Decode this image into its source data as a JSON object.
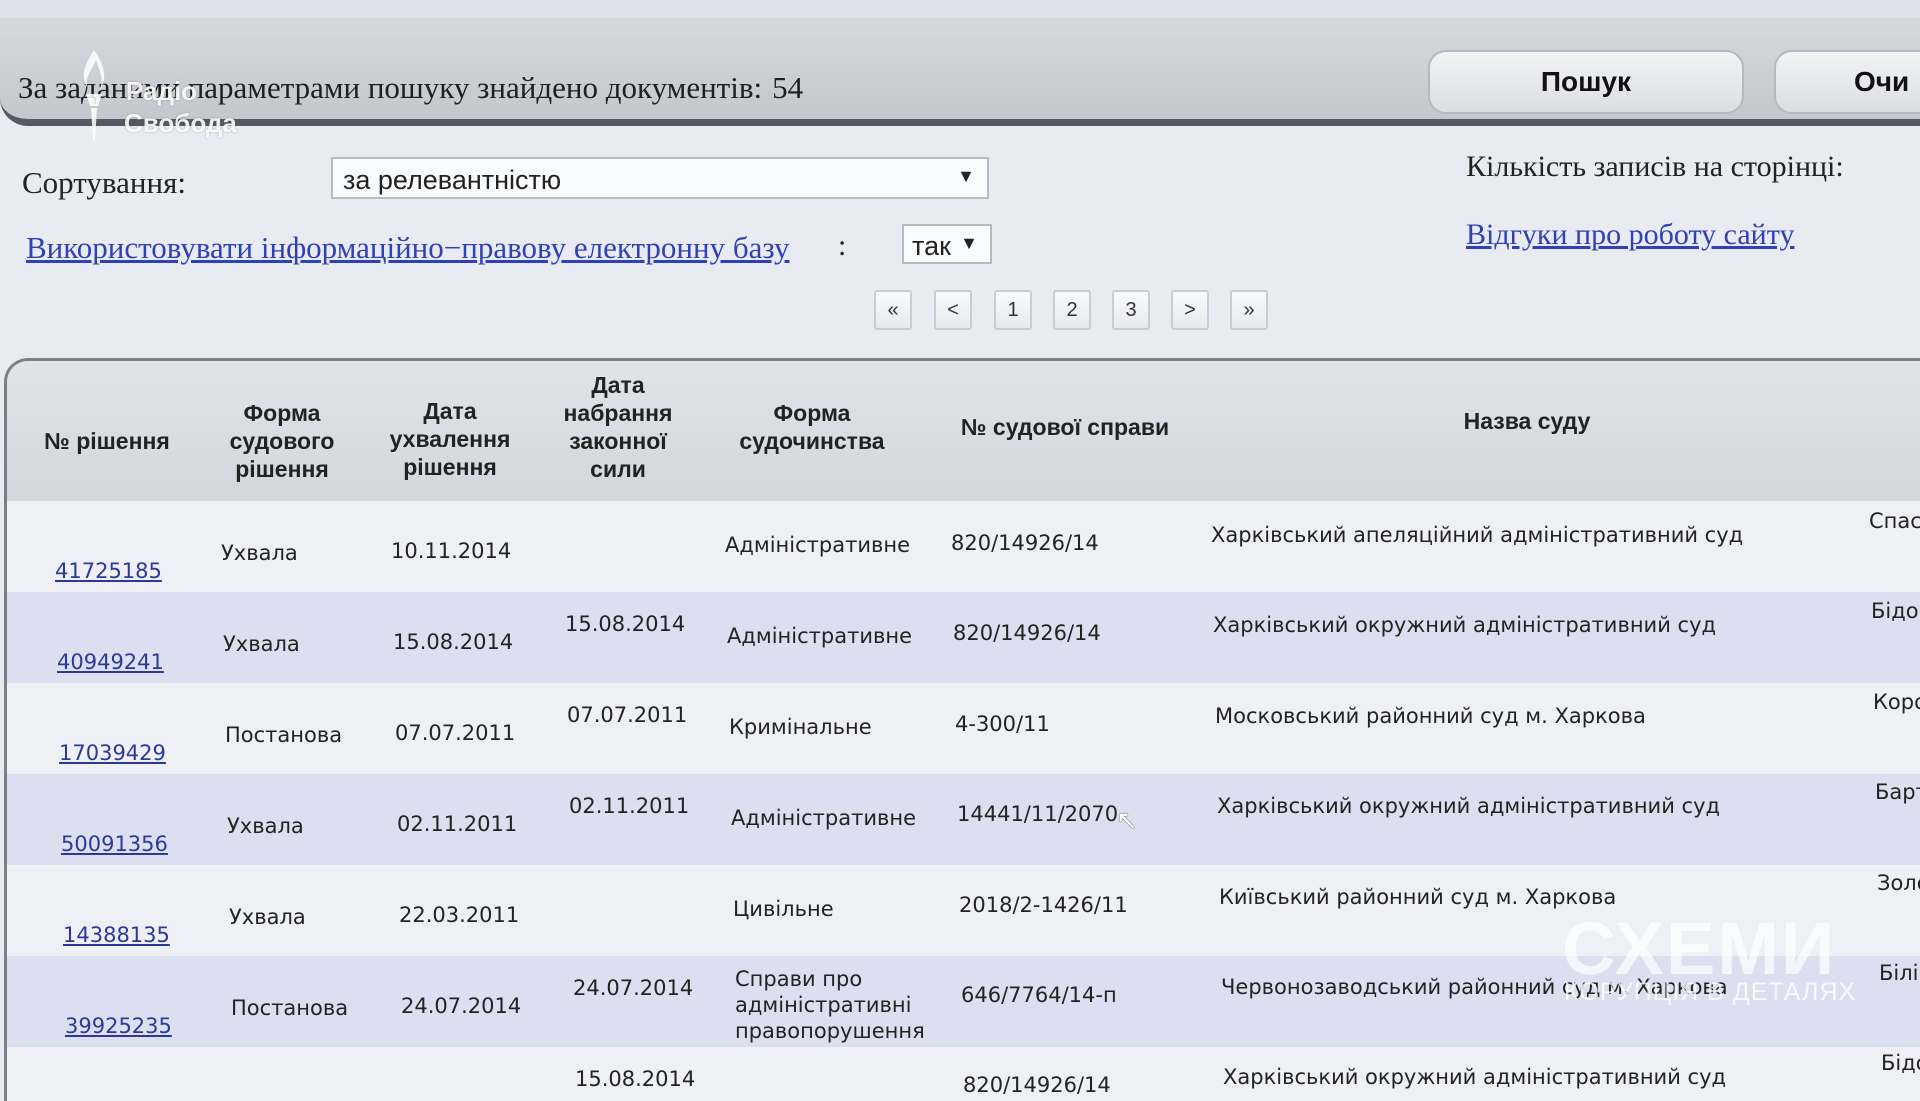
{
  "header": {
    "found_text": "За заданими параметрами пошуку знайдено документів:",
    "found_count": "54",
    "search_button": "Пошук",
    "clear_button": "Очи"
  },
  "watermark_top": {
    "line1": "Радіо",
    "line2": "Свобода"
  },
  "controls": {
    "sort_label": "Сортування:",
    "sort_value": "за релевантністю",
    "records_per_page_label": "Кількість записів на сторінці:",
    "db_link": "Використовувати інформаційно−правову електронну базу",
    "db_colon": ":",
    "db_value": "так",
    "feedback_link": "Відгуки про роботу сайту",
    "dropdown_arrow": "▼"
  },
  "pagination": {
    "first": "«",
    "prev": "<",
    "pages": [
      "1",
      "2",
      "3"
    ],
    "next": ">",
    "last": "»"
  },
  "table": {
    "columns": [
      "№ рішення",
      "Форма судового рішення",
      "Дата ухвалення рішення",
      "Дата набрання законної сили",
      "Форма судочинства",
      "№ судової справи",
      "Назва суду"
    ],
    "rows": [
      {
        "id": "41725185",
        "form": "Ухвала",
        "date": "10.11.2014",
        "legal_date": "",
        "proceeding": "Адміністративне",
        "case": "820/14926/14",
        "court": "Харківський апеляційний адміністративний суд",
        "judge": "Спасс"
      },
      {
        "id": "40949241",
        "form": "Ухвала",
        "date": "15.08.2014",
        "legal_date": "15.08.2014",
        "proceeding": "Адміністративне",
        "case": "820/14926/14",
        "court": "Харківський окружний адміністративний суд",
        "judge": "Бідон"
      },
      {
        "id": "17039429",
        "form": "Постанова",
        "date": "07.07.2011",
        "legal_date": "07.07.2011",
        "proceeding": "Кримінальне",
        "case": "4-300/11",
        "court": "Московський районний суд м. Харкова",
        "judge": "Корот"
      },
      {
        "id": "50091356",
        "form": "Ухвала",
        "date": "02.11.2011",
        "legal_date": "02.11.2011",
        "proceeding": "Адміністративне",
        "case": "14441/11/2070",
        "court": "Харківський окружний адміністративний суд",
        "judge": "Барто"
      },
      {
        "id": "14388135",
        "form": "Ухвала",
        "date": "22.03.2011",
        "legal_date": "",
        "proceeding": "Цивільне",
        "case": "2018/2-1426/11",
        "court": "Київський районний суд м. Харкова",
        "judge": "Золот"
      },
      {
        "id": "39925235",
        "form": "Постанова",
        "date": "24.07.2014",
        "legal_date": "24.07.2014",
        "proceeding": "Справи про адміністративні правопорушення",
        "case": "646/7764/14-п",
        "court": "Червонозаводський районний суд м. Харкова",
        "judge": "Білінс"
      },
      {
        "id": "",
        "form": "",
        "date": "",
        "legal_date": "15.08.2014",
        "proceeding": "",
        "case": "820/14926/14",
        "court": "Харківський окружний адміністративний суд",
        "judge": "Бідон"
      }
    ]
  },
  "watermark_bottom": {
    "title": "СХЕМИ",
    "subtitle": "КОРУПЦІЯ В ДЕТАЛЯХ"
  },
  "colors": {
    "link": "#3040b7",
    "row_alt": "#dcdff0",
    "row_base": "#eef0f6"
  }
}
